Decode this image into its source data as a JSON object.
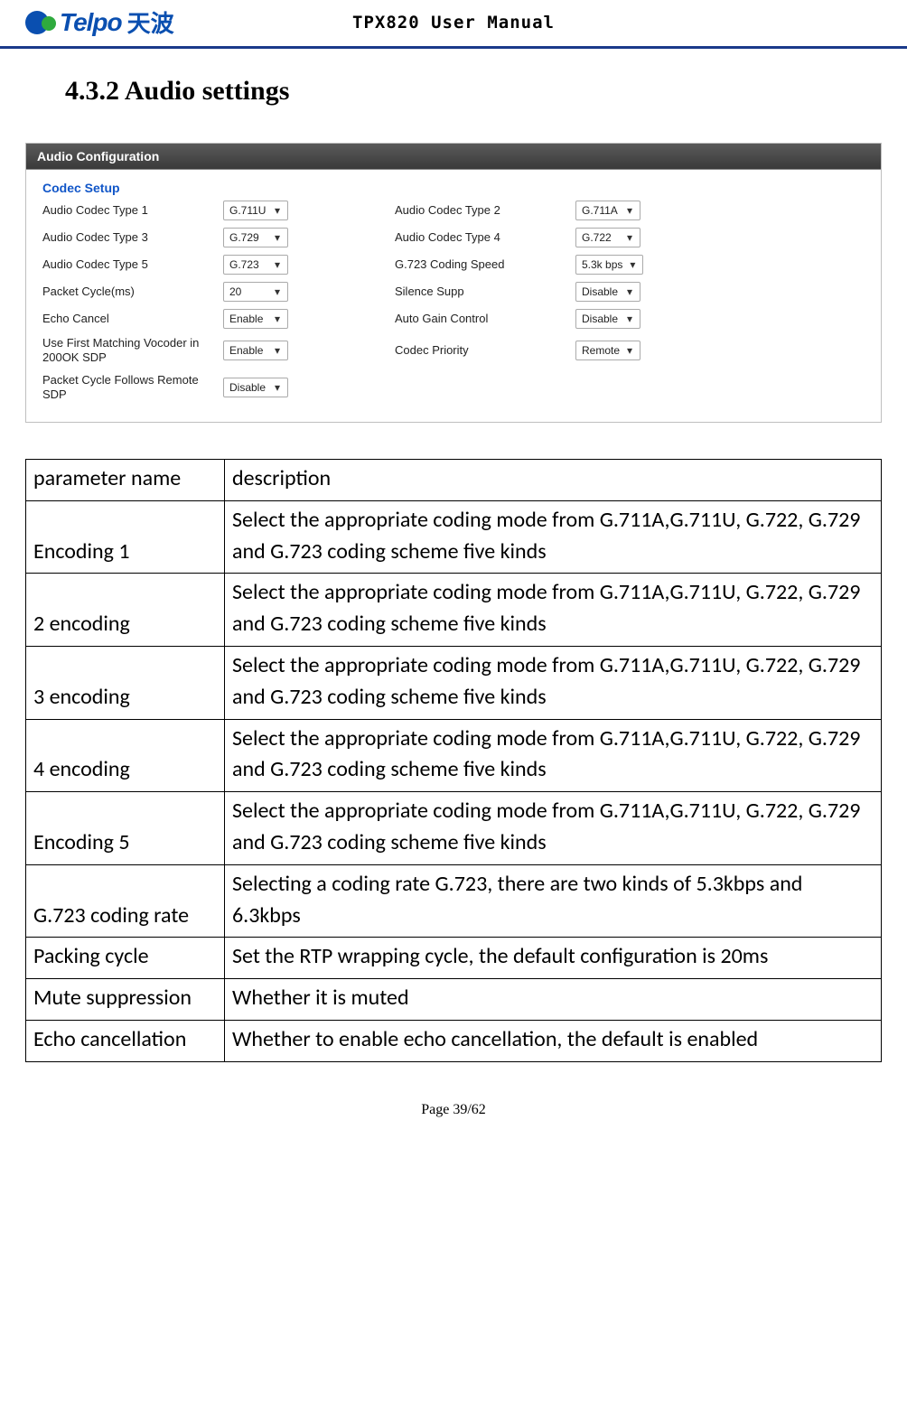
{
  "header": {
    "logo_text": "Telpo",
    "logo_cn": "天波",
    "doc_title": "TPX820 User Manual"
  },
  "section": {
    "heading": "4.3.2 Audio settings"
  },
  "panel": {
    "title": "Audio Configuration",
    "group_title": "Codec Setup",
    "rows": [
      {
        "l1": "Audio Codec Type 1",
        "v1": "G.711U",
        "l2": "Audio Codec Type 2",
        "v2": "G.711A"
      },
      {
        "l1": "Audio Codec Type 3",
        "v1": "G.729",
        "l2": "Audio Codec Type 4",
        "v2": "G.722"
      },
      {
        "l1": "Audio Codec Type 5",
        "v1": "G.723",
        "l2": "G.723 Coding Speed",
        "v2": "5.3k bps"
      },
      {
        "l1": "Packet Cycle(ms)",
        "v1": "20",
        "l2": "Silence Supp",
        "v2": "Disable"
      },
      {
        "l1": "Echo Cancel",
        "v1": "Enable",
        "l2": "Auto Gain Control",
        "v2": "Disable"
      },
      {
        "l1": "Use First Matching Vocoder in 200OK SDP",
        "v1": "Enable",
        "l2": "Codec Priority",
        "v2": "Remote"
      },
      {
        "l1": "Packet Cycle Follows Remote SDP",
        "v1": "Disable",
        "l2": "",
        "v2": ""
      }
    ]
  },
  "table": {
    "header": {
      "name": "parameter name",
      "desc": "description"
    },
    "rows": [
      {
        "name": "Encoding 1",
        "desc": "Select the appropriate coding mode from G.711A,G.711U, G.722, G.729 and G.723 coding scheme five kinds"
      },
      {
        "name": "2 encoding",
        "desc": "Select the appropriate coding mode from G.711A,G.711U, G.722, G.729 and G.723 coding scheme five kinds"
      },
      {
        "name": "3 encoding",
        "desc": "Select the appropriate coding mode from G.711A,G.711U, G.722, G.729 and G.723 coding scheme five kinds"
      },
      {
        "name": "4 encoding",
        "desc": "Select the appropriate coding mode from G.711A,G.711U, G.722, G.729 and G.723 coding scheme five kinds"
      },
      {
        "name": "Encoding 5",
        "desc": "Select the appropriate coding mode from G.711A,G.711U, G.722, G.729 and G.723 coding scheme five kinds"
      },
      {
        "name": "G.723 coding rate",
        "desc": "Selecting a coding rate G.723, there are two kinds of 5.3kbps and 6.3kbps"
      },
      {
        "name": "Packing cycle",
        "desc": "Set the RTP wrapping cycle, the default configuration is 20ms"
      },
      {
        "name": "Mute suppression",
        "desc": "Whether it is muted"
      },
      {
        "name": "Echo cancellation",
        "desc": "Whether to enable echo cancellation, the default is enabled"
      }
    ]
  },
  "footer": {
    "page": "Page 39/62"
  }
}
